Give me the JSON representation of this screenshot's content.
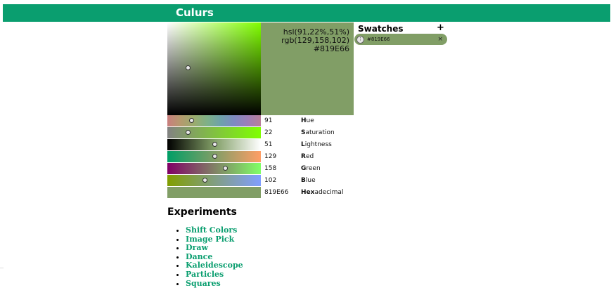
{
  "app": {
    "title": "Culurs"
  },
  "preview": {
    "hsl": "hsl(91,22%,51%)",
    "rgb": "rgb(129,158,102)",
    "hex": "#819E66",
    "color": "#819e66"
  },
  "sliders": [
    {
      "value": "91",
      "key": "H",
      "rest": "ue",
      "level": 0.25
    },
    {
      "value": "22",
      "key": "S",
      "rest": "aturation",
      "level": 0.22
    },
    {
      "value": "51",
      "key": "L",
      "rest": "ightness",
      "level": 0.51
    },
    {
      "value": "129",
      "key": "R",
      "rest": "ed",
      "level": 0.506
    },
    {
      "value": "158",
      "key": "G",
      "rest": "reen",
      "level": 0.62
    },
    {
      "value": "102",
      "key": "B",
      "rest": "lue",
      "level": 0.4
    },
    {
      "value": "819E66",
      "key": "Hex",
      "rest": "adecimal"
    }
  ],
  "swatches": {
    "title": "Swatches",
    "add_label": "+",
    "items": [
      {
        "hex": "#819E66",
        "remove_label": "×"
      }
    ]
  },
  "experiments": {
    "title": "Experiments",
    "items": [
      "Shift Colors",
      "Image Pick",
      "Draw",
      "Dance",
      "Kaleidescope",
      "Particles",
      "Squares"
    ]
  },
  "colors": {
    "accent": "#0a9e6f",
    "current": "#819e66"
  }
}
